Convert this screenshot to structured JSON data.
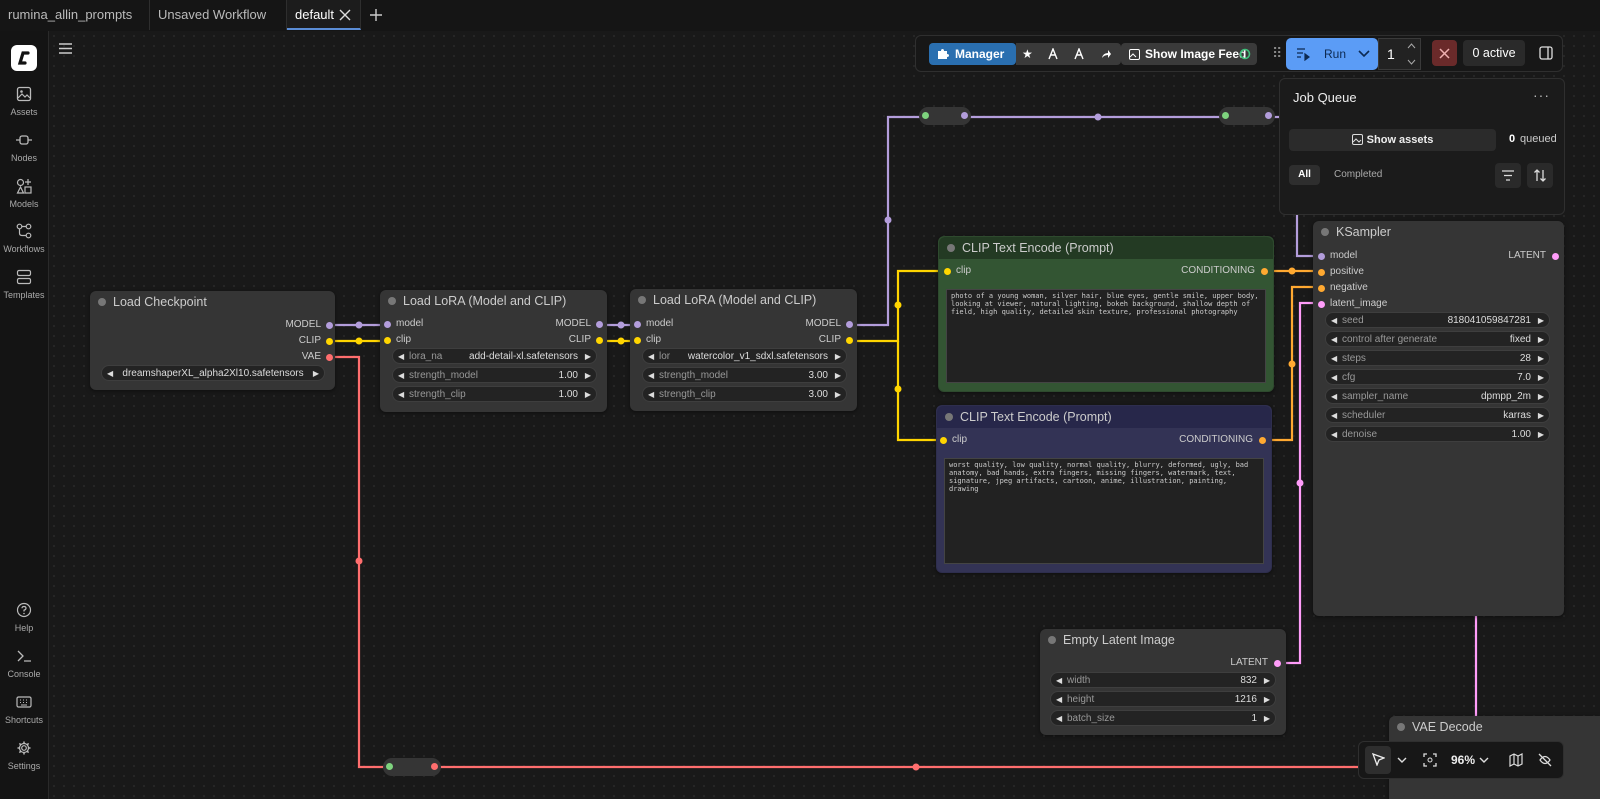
{
  "tabs": [
    {
      "label": "rumina_allin_prompts"
    },
    {
      "label": "Unsaved Workflow"
    },
    {
      "label": "default"
    }
  ],
  "sidebar": {
    "items": [
      {
        "label": "Assets",
        "icon": "image-icon"
      },
      {
        "label": "Nodes",
        "icon": "node-icon"
      },
      {
        "label": "Models",
        "icon": "shapes-icon"
      },
      {
        "label": "Workflows",
        "icon": "workflow-icon"
      },
      {
        "label": "Templates",
        "icon": "template-icon"
      }
    ],
    "bottom_items": [
      {
        "label": "Help",
        "icon": "help-icon"
      },
      {
        "label": "Console",
        "icon": "terminal-icon"
      },
      {
        "label": "Shortcuts",
        "icon": "keyboard-icon"
      },
      {
        "label": "Settings",
        "icon": "gear-icon"
      }
    ]
  },
  "toolbar": {
    "manager_label": "Manager",
    "show_feed_label": "Show Image Feed",
    "run_label": "Run",
    "batch_count": "1",
    "active_label": "0 active"
  },
  "job_queue": {
    "title": "Job Queue",
    "show_assets": "Show assets",
    "queued_count": "0",
    "queued_label": "queued",
    "filter_all": "All",
    "filter_completed": "Completed"
  },
  "zoom": {
    "level": "96%"
  },
  "colors": {
    "model": "#b39ddb",
    "clip": "#ffd500",
    "vae": "#ff6e6e",
    "conditioning": "#ffa931",
    "latent": "#ff9cf9",
    "positive_node": "#335533",
    "negative_node": "#333355",
    "accent": "#5b9cf6"
  },
  "nodes": {
    "load_checkpoint": {
      "title": "Load Checkpoint",
      "outputs": [
        "MODEL",
        "CLIP",
        "VAE"
      ],
      "ckpt_name": "dreamshaperXL_alpha2Xl10.safetensors"
    },
    "lora1": {
      "title": "Load LoRA (Model and CLIP)",
      "inputs": [
        "model",
        "clip"
      ],
      "outputs": [
        "MODEL",
        "CLIP"
      ],
      "lora_name_label": "lora_na",
      "lora_name": "add-detail-xl.safetensors",
      "strength_model_label": "strength_model",
      "strength_model": "1.00",
      "strength_clip_label": "strength_clip",
      "strength_clip": "1.00"
    },
    "lora2": {
      "title": "Load LoRA (Model and CLIP)",
      "inputs": [
        "model",
        "clip"
      ],
      "outputs": [
        "MODEL",
        "CLIP"
      ],
      "lora_name_label": "lor",
      "lora_name": "watercolor_v1_sdxl.safetensors",
      "strength_model_label": "strength_model",
      "strength_model": "3.00",
      "strength_clip_label": "strength_clip",
      "strength_clip": "3.00"
    },
    "clip_pos": {
      "title": "CLIP Text Encode (Prompt)",
      "input": "clip",
      "output": "CONDITIONING",
      "text": "photo of a young woman, silver hair, blue eyes, gentle smile, upper body, looking at viewer, natural lighting, bokeh background, shallow depth of field, high quality, detailed skin texture, professional photography"
    },
    "clip_neg": {
      "title": "CLIP Text Encode (Prompt)",
      "input": "clip",
      "output": "CONDITIONING",
      "text": "worst quality, low quality, normal quality, blurry, deformed, ugly, bad anatomy, bad hands, extra fingers, missing fingers, watermark, text, signature, jpeg artifacts, cartoon, anime, illustration, painting, drawing"
    },
    "ksampler": {
      "title": "KSampler",
      "inputs": [
        "model",
        "positive",
        "negative",
        "latent_image"
      ],
      "output": "LATENT",
      "widgets": [
        {
          "name": "seed",
          "value": "818041059847281"
        },
        {
          "name": "control after generate",
          "value": "fixed"
        },
        {
          "name": "steps",
          "value": "28"
        },
        {
          "name": "cfg",
          "value": "7.0"
        },
        {
          "name": "sampler_name",
          "value": "dpmpp_2m"
        },
        {
          "name": "scheduler",
          "value": "karras"
        },
        {
          "name": "denoise",
          "value": "1.00"
        }
      ]
    },
    "empty_latent": {
      "title": "Empty Latent Image",
      "output": "LATENT",
      "widgets": [
        {
          "name": "width",
          "value": "832"
        },
        {
          "name": "height",
          "value": "1216"
        },
        {
          "name": "batch_size",
          "value": "1"
        }
      ]
    },
    "vae_decode": {
      "title": "VAE Decode"
    }
  }
}
